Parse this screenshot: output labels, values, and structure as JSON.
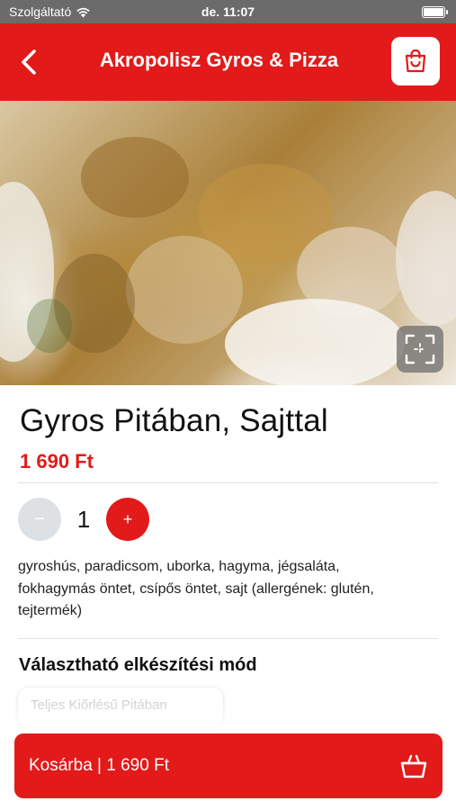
{
  "status_bar": {
    "carrier": "Szolgáltató",
    "time": "de. 11:07"
  },
  "header": {
    "title": "Akropolisz Gyros & Pizza"
  },
  "product": {
    "name": "Gyros Pitában, Sajttal",
    "price": "1 690 Ft",
    "quantity": "1",
    "minus_label": "−",
    "plus_label": "+",
    "description": "gyroshús, paradicsom, uborka, hagyma, jégsaláta, fokhagymás öntet, csípős öntet, sajt (allergének: glutén, tejtermék)"
  },
  "options": {
    "title": "Választható elkészítési mód",
    "items": [
      {
        "label": "Teljes Kiőrlésű Pitában"
      }
    ]
  },
  "cart_button": {
    "label": "Kosárba | 1 690 Ft"
  },
  "colors": {
    "brand_red": "#e21a1a",
    "minus_bg": "#dde1e4"
  },
  "icons": {
    "back": "chevron-left-icon",
    "cart_top": "shopping-bag-icon",
    "zoom": "expand-icon",
    "cart_bottom": "basket-icon"
  }
}
